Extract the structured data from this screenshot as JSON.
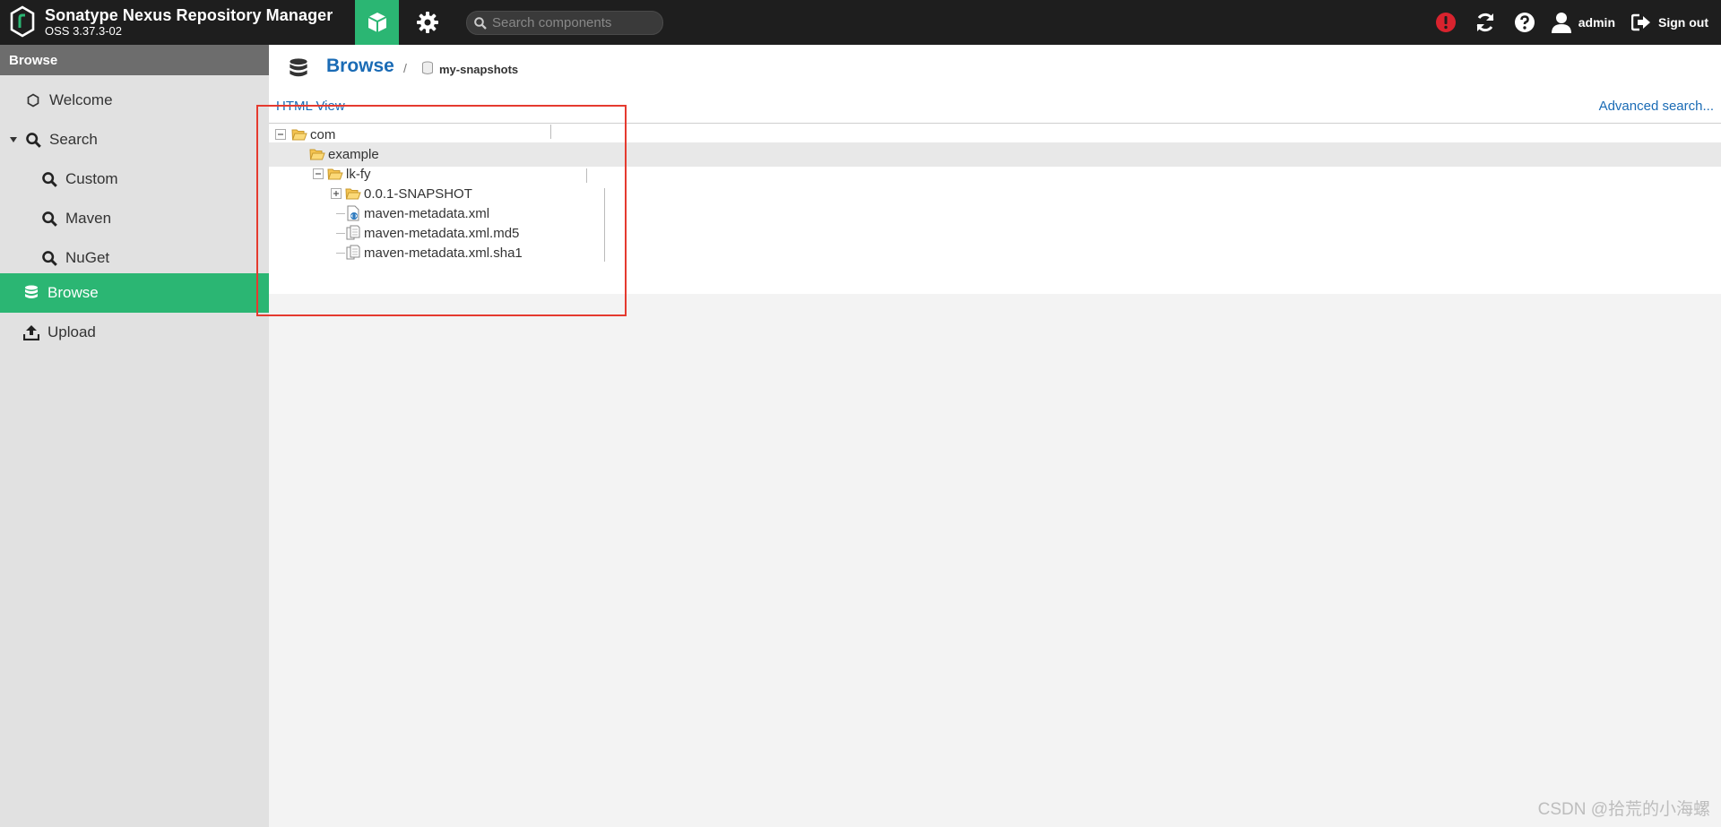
{
  "app": {
    "title": "Sonatype Nexus Repository Manager",
    "version": "OSS 3.37.3-02"
  },
  "search": {
    "placeholder": "Search components"
  },
  "user": {
    "name": "admin",
    "signout_label": "Sign out"
  },
  "colors": {
    "accent": "#2bb673",
    "link": "#1a6bb5",
    "alert": "#d9232e",
    "highlight": "#e53a2f"
  },
  "sidebar": {
    "header": "Browse",
    "items": [
      {
        "label": "Welcome",
        "icon": "hexagon-icon"
      },
      {
        "label": "Search",
        "icon": "search-icon",
        "expanded": true
      },
      {
        "label": "Custom",
        "icon": "search-icon"
      },
      {
        "label": "Maven",
        "icon": "search-icon"
      },
      {
        "label": "NuGet",
        "icon": "search-icon"
      },
      {
        "label": "Browse",
        "icon": "database-icon",
        "active": true
      },
      {
        "label": "Upload",
        "icon": "upload-icon"
      }
    ]
  },
  "main": {
    "title": "Browse",
    "separator": "/",
    "repository": "my-snapshots",
    "html_view_label": "HTML View",
    "advanced_search_label": "Advanced search..."
  },
  "tree": [
    {
      "label": "com",
      "type": "folder",
      "depth": 0,
      "expanded": true
    },
    {
      "label": "example",
      "type": "folder",
      "depth": 1,
      "expanded": true,
      "selected": true
    },
    {
      "label": "lk-fy",
      "type": "folder",
      "depth": 2,
      "expanded": true
    },
    {
      "label": "0.0.1-SNAPSHOT",
      "type": "folder",
      "depth": 3,
      "expanded": false
    },
    {
      "label": "maven-metadata.xml",
      "type": "xml-file",
      "depth": 3
    },
    {
      "label": "maven-metadata.xml.md5",
      "type": "file",
      "depth": 3
    },
    {
      "label": "maven-metadata.xml.sha1",
      "type": "file",
      "depth": 3
    }
  ],
  "watermark": "CSDN @拾荒的小海螺"
}
